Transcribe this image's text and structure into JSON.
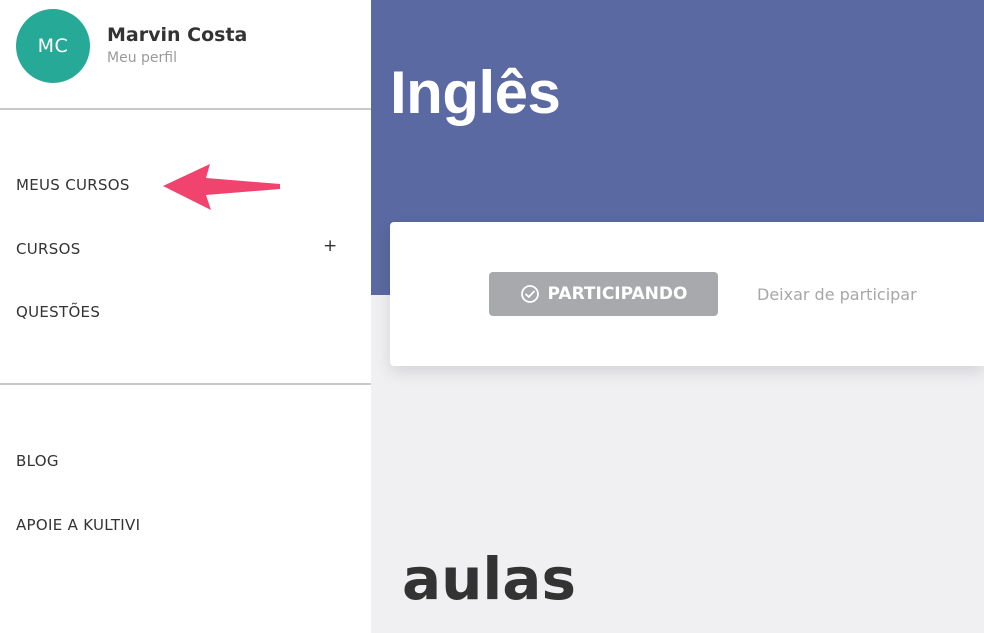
{
  "profile": {
    "initials": "MC",
    "name": "Marvin Costa",
    "subtitle": "Meu perfil",
    "avatar_color": "#26a996"
  },
  "nav": {
    "primary": [
      {
        "label": "MEUS CURSOS",
        "highlighted_by_arrow": true
      },
      {
        "label": "CURSOS",
        "expand_symbol": "+"
      },
      {
        "label": "QUESTÕES"
      }
    ],
    "secondary": [
      {
        "label": "BLOG"
      },
      {
        "label": "APOIE A KULTIVI"
      }
    ],
    "arrow_icon": "arrow-left-icon",
    "arrow_color": "#f0436e"
  },
  "course": {
    "title": "Inglês",
    "hero_color": "#5b69a2",
    "status_button": {
      "label": "PARTICIPANDO",
      "icon": "check-circle-icon"
    },
    "leave_link": "Deixar de participar"
  },
  "section": {
    "title": "aulas"
  }
}
